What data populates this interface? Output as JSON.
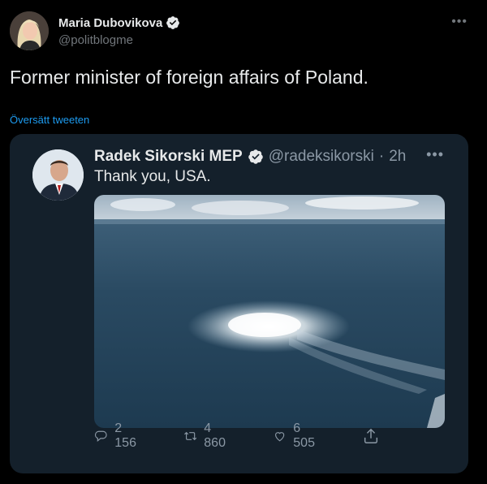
{
  "tweet": {
    "author_name": "Maria Dubovikova",
    "author_handle": "@politblogme",
    "text": "Former minister of foreign affairs of Poland.",
    "translate_label": "Översätt tweeten"
  },
  "quoted": {
    "author_name": "Radek Sikorski MEP",
    "author_handle": "@radeksikorski",
    "separator": "·",
    "time": "2h",
    "text": "Thank you, USA.",
    "replies": "2 156",
    "retweets": "4 860",
    "likes": "6 505"
  },
  "colors": {
    "background": "#000000",
    "card": "#14202b",
    "link": "#1d9bf0",
    "muted": "#8b98a5"
  },
  "icons": [
    "verified-badge-icon",
    "more-icon",
    "reply-icon",
    "retweet-icon",
    "like-icon",
    "share-icon"
  ]
}
